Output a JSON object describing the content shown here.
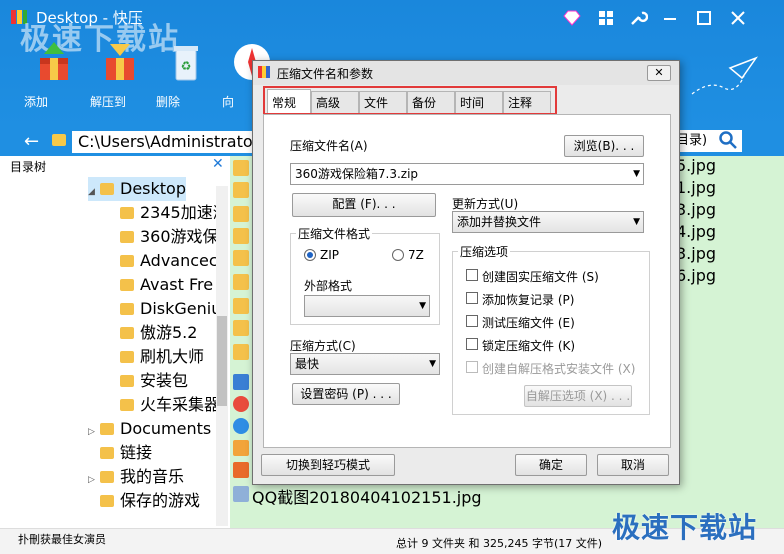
{
  "app": {
    "title": "Desktop - 快压",
    "watermark": "极速下载站",
    "toolbar": [
      {
        "label": "添加",
        "icon": "add-archive-icon"
      },
      {
        "label": "解压到",
        "icon": "extract-to-icon"
      },
      {
        "label": "删除",
        "icon": "recycle-bin-icon"
      },
      {
        "label": "向",
        "icon": "wizard-icon"
      }
    ],
    "path": "C:\\Users\\Administrator\\",
    "search_suffix": "目录)",
    "tree_header": "目录树",
    "tree": [
      {
        "label": "Desktop",
        "level": 1,
        "expanded": true,
        "selected": true
      },
      {
        "label": "2345加速浏",
        "level": 2
      },
      {
        "label": "360游戏保",
        "level": 2
      },
      {
        "label": "Advancec",
        "level": 2
      },
      {
        "label": "Avast Fre",
        "level": 2
      },
      {
        "label": "DiskGeniu",
        "level": 2
      },
      {
        "label": "傲游5.2",
        "level": 2
      },
      {
        "label": "刷机大师",
        "level": 2
      },
      {
        "label": "安装包",
        "level": 2
      },
      {
        "label": "火车采集器",
        "level": 2
      },
      {
        "label": "Documents",
        "level": 1
      },
      {
        "label": "链接",
        "level": 1
      },
      {
        "label": "我的音乐",
        "level": 1
      },
      {
        "label": "保存的游戏",
        "level": 1
      }
    ],
    "files": [
      "5.jpg",
      "1.jpg",
      "3.jpg",
      "4.jpg",
      "3.jpg",
      "6.jpg"
    ],
    "last_file": "QQ截图20180404102151.jpg",
    "status_left": "扑刪获最佳女演员",
    "status_right": "总计 9 文件夹 和 325,245 字节(17 文件)"
  },
  "dialog": {
    "title": "压缩文件名和参数",
    "close_label": "✕",
    "tabs": [
      "常规",
      "高级",
      "文件",
      "备份",
      "时间",
      "注释"
    ],
    "archive_name_label": "压缩文件名(A)",
    "browse_label": "浏览(B). . .",
    "archive_name_value": "360游戏保险箱7.3.zip",
    "config_label": "配置 (F). . .",
    "update_mode_label": "更新方式(U)",
    "update_mode_value": "添加并替换文件",
    "format_group_title": "压缩文件格式",
    "format_zip": "ZIP",
    "format_7z": "7Z",
    "external_format_label": "外部格式",
    "options_group_title": "压缩选项",
    "options": [
      {
        "label": "创建固实压缩文件 (S)",
        "checked": false,
        "disabled": false
      },
      {
        "label": "添加恢复记录 (P)",
        "checked": false,
        "disabled": false
      },
      {
        "label": "测试压缩文件 (E)",
        "checked": false,
        "disabled": false
      },
      {
        "label": "锁定压缩文件 (K)",
        "checked": false,
        "disabled": false
      },
      {
        "label": "创建自解压格式安装文件 (X)",
        "checked": false,
        "disabled": true
      }
    ],
    "method_label": "压缩方式(C)",
    "method_value": "最快",
    "password_label": "设置密码 (P) . . .",
    "sfx_options_label": "自解压选项 (X) . . .",
    "light_mode_label": "切换到轻巧模式",
    "ok_label": "确定",
    "cancel_label": "取消"
  }
}
